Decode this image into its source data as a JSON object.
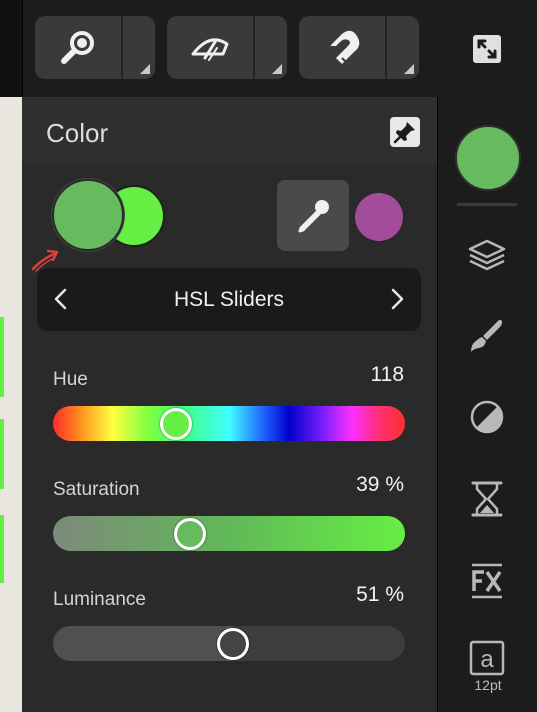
{
  "toolbar": {
    "groups": [
      {
        "icon": "zoom-icon"
      },
      {
        "icon": "view-gauge-icon"
      },
      {
        "icon": "magnet-icon"
      }
    ],
    "expand_icon": "expand-icon"
  },
  "panel": {
    "title": "Color",
    "pin_icon": "pin-icon",
    "primary_color": "#66bb5e",
    "secondary_color": "#66ee44",
    "picked_color": "#a34c9a",
    "mode": "HSL Sliders"
  },
  "sliders": {
    "hue": {
      "label": "Hue",
      "value": "118",
      "position": 0.35
    },
    "saturation": {
      "label": "Saturation",
      "value": "39 %",
      "position": 0.39
    },
    "luminance": {
      "label": "Luminance",
      "value": "51 %",
      "position": 0.51
    }
  },
  "sidebar": {
    "swatch_color": "#66bb5e",
    "icons": [
      "layers-icon",
      "brush-icon",
      "adjustments-icon",
      "hourglass-icon",
      "fx-icon",
      "text-style-icon"
    ],
    "font_size": "12pt"
  }
}
